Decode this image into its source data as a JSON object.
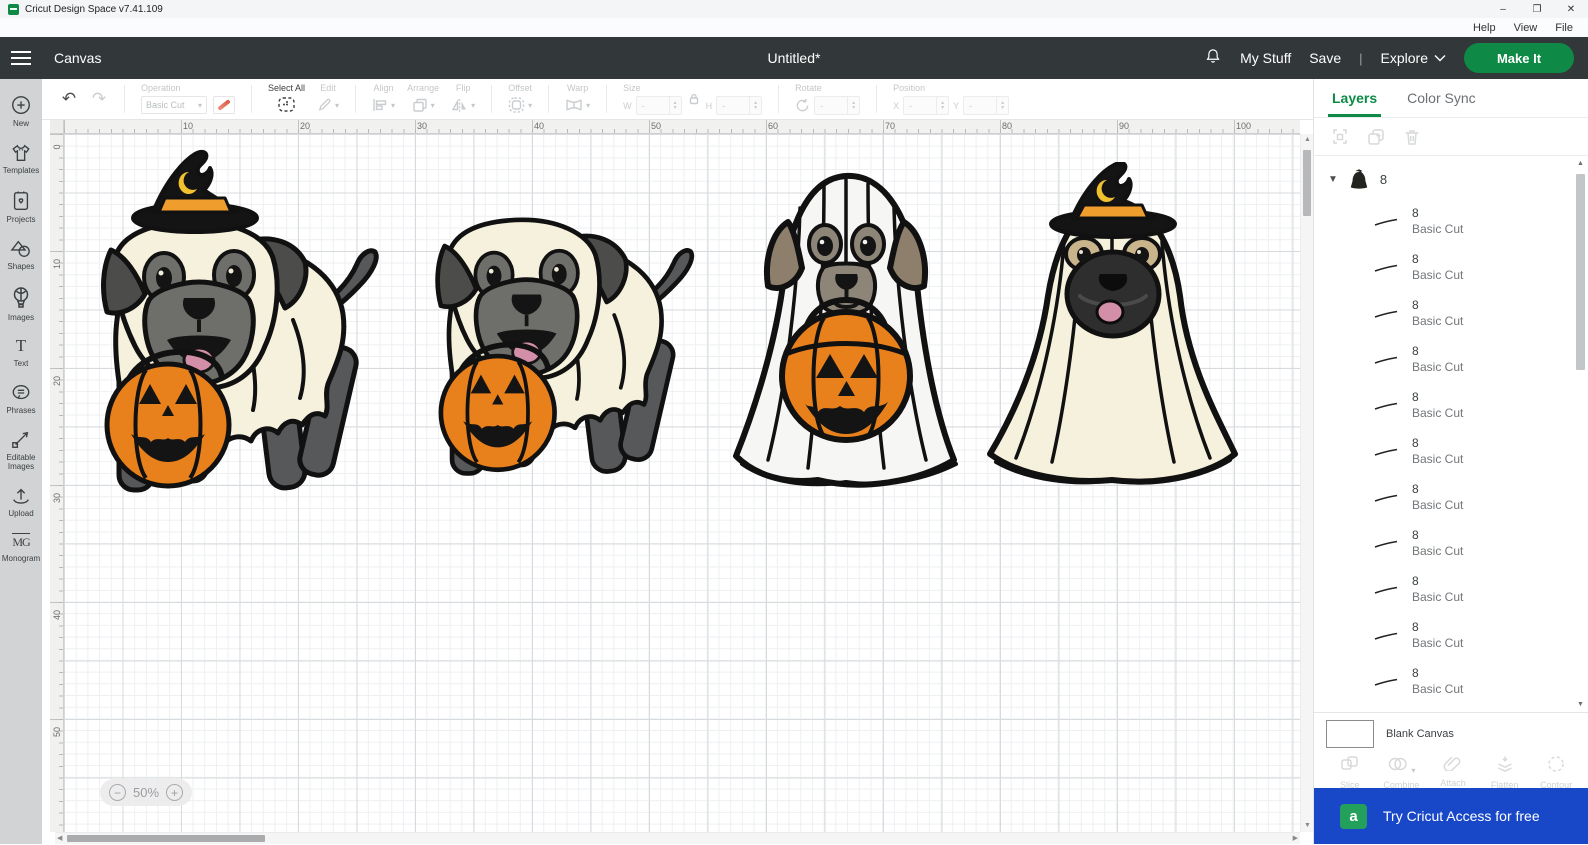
{
  "window": {
    "title": "Cricut Design Space  v7.41.109",
    "controls": {
      "minimize": "–",
      "maximize": "❐",
      "close": "✕"
    }
  },
  "menubar": {
    "items": [
      "Help",
      "View",
      "File"
    ]
  },
  "header": {
    "canvas": "Canvas",
    "doc_title": "Untitled*",
    "my_stuff": "My Stuff",
    "save": "Save",
    "divider": "|",
    "explore": "Explore",
    "make_it": "Make It"
  },
  "toolbar": {
    "operation_label": "Operation",
    "operation_value": "Basic Cut",
    "select_all": "Select All",
    "edit": "Edit",
    "align": "Align",
    "arrange": "Arrange",
    "flip": "Flip",
    "offset": "Offset",
    "warp": "Warp",
    "size_label": "Size",
    "w_label": "W",
    "h_label": "H",
    "rotate_label": "Rotate",
    "position_label": "Position",
    "x_label": "X",
    "y_label": "Y",
    "empty_value": "-"
  },
  "sidebar": {
    "items": [
      {
        "label": "New",
        "icon": "plus-circle-icon"
      },
      {
        "label": "Templates",
        "icon": "tshirt-icon"
      },
      {
        "label": "Projects",
        "icon": "project-card-icon"
      },
      {
        "label": "Shapes",
        "icon": "shapes-icon"
      },
      {
        "label": "Images",
        "icon": "balloon-icon"
      },
      {
        "label": "Text",
        "icon": "text-icon"
      },
      {
        "label": "Phrases",
        "icon": "speech-bubble-icon"
      },
      {
        "label": "Editable Images",
        "icon": "editable-path-icon"
      },
      {
        "label": "Upload",
        "icon": "upload-arrow-icon"
      },
      {
        "label": "Monogram",
        "icon": "monogram-icon"
      }
    ]
  },
  "canvas": {
    "h_ruler": [
      10,
      20,
      30,
      40,
      50,
      60,
      70,
      80,
      90,
      100
    ],
    "v_ruler": [
      0,
      10,
      20,
      30,
      40,
      50
    ],
    "zoom_level": "50%",
    "artwork": [
      "ghost-dog-side-hat",
      "ghost-dog-side",
      "ghost-dog-front-pumpkin",
      "ghost-pug-front-hat"
    ]
  },
  "layers_panel": {
    "tabs": [
      "Layers",
      "Color Sync"
    ],
    "group": {
      "name": "8"
    },
    "layers": [
      {
        "name": "8",
        "type": "Basic Cut"
      },
      {
        "name": "8",
        "type": "Basic Cut"
      },
      {
        "name": "8",
        "type": "Basic Cut"
      },
      {
        "name": "8",
        "type": "Basic Cut"
      },
      {
        "name": "8",
        "type": "Basic Cut"
      },
      {
        "name": "8",
        "type": "Basic Cut"
      },
      {
        "name": "8",
        "type": "Basic Cut"
      },
      {
        "name": "8",
        "type": "Basic Cut"
      },
      {
        "name": "8",
        "type": "Basic Cut"
      },
      {
        "name": "8",
        "type": "Basic Cut"
      },
      {
        "name": "8",
        "type": "Basic Cut"
      }
    ],
    "blank_canvas": "Blank Canvas",
    "actions": [
      {
        "label": "Slice",
        "icon": "slice-icon",
        "has_dropdown": false
      },
      {
        "label": "Combine",
        "icon": "combine-icon",
        "has_dropdown": true
      },
      {
        "label": "Attach",
        "icon": "attach-icon",
        "has_dropdown": false
      },
      {
        "label": "Flatten",
        "icon": "flatten-icon",
        "has_dropdown": false
      },
      {
        "label": "Contour",
        "icon": "contour-icon",
        "has_dropdown": false
      }
    ],
    "banner": {
      "text": "Try Cricut Access for free",
      "icon_letter": "a"
    }
  },
  "colors": {
    "brand_green": "#0e8a46",
    "banner_blue": "#1848c8",
    "pumpkin_orange": "#e8811c",
    "sheet_cream": "#f5f1dd",
    "header_dark": "#32373a"
  }
}
